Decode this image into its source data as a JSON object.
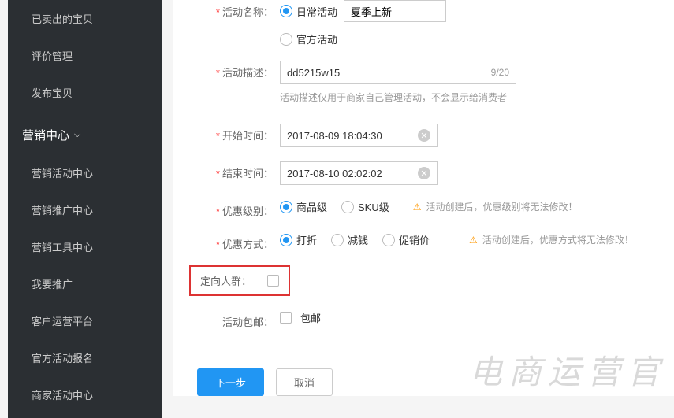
{
  "sidebar": {
    "group1": {
      "items": [
        {
          "label": "已卖出的宝贝"
        },
        {
          "label": "评价管理"
        },
        {
          "label": "发布宝贝"
        }
      ]
    },
    "group2": {
      "header": "营销中心",
      "items": [
        {
          "label": "营销活动中心"
        },
        {
          "label": "营销推广中心"
        },
        {
          "label": "营销工具中心"
        },
        {
          "label": "我要推广"
        },
        {
          "label": "客户运营平台"
        },
        {
          "label": "官方活动报名"
        },
        {
          "label": "商家活动中心"
        }
      ]
    }
  },
  "form": {
    "activityName": {
      "label": "活动名称：",
      "options": [
        "日常活动",
        "官方活动"
      ],
      "selected": 0,
      "value": "夏季上新"
    },
    "activityDesc": {
      "label": "活动描述：",
      "value": "dd5215w15",
      "counter": "9/20",
      "hint": "活动描述仅用于商家自己管理活动，不会显示给消费者"
    },
    "startTime": {
      "label": "开始时间：",
      "value": "2017-08-09 18:04:30"
    },
    "endTime": {
      "label": "结束时间：",
      "value": "2017-08-10 02:02:02"
    },
    "discountLevel": {
      "label": "优惠级别：",
      "options": [
        "商品级",
        "SKU级"
      ],
      "selected": 0,
      "warning": "活动创建后，优惠级别将无法修改！"
    },
    "discountType": {
      "label": "优惠方式：",
      "options": [
        "打折",
        "减钱",
        "促销价"
      ],
      "selected": 0,
      "warning": "活动创建后，优惠方式将无法修改！"
    },
    "targetGroup": {
      "label": "定向人群："
    },
    "freeShipping": {
      "label": "活动包邮：",
      "option": "包邮"
    }
  },
  "buttons": {
    "next": "下一步",
    "cancel": "取消"
  },
  "watermark": "电商运营官"
}
